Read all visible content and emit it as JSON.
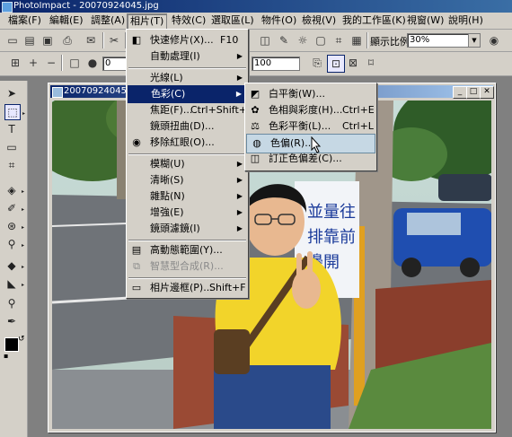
{
  "app": {
    "title": "PhotoImpact - 20070924045.jpg"
  },
  "menubar": {
    "items": [
      "檔案(F)",
      "編輯(E)",
      "調整(A)",
      "相片(T)",
      "特效(C)",
      "選取區(L)",
      "物件(O)",
      "檢視(V)",
      "我的工作區(K)",
      "視窗(W)",
      "說明(H)"
    ]
  },
  "toolbar": {
    "zoom_label": "顯示比例",
    "zoom_value": "30%"
  },
  "attr_bar": {
    "field_left_value": "0",
    "field_right_value": "100"
  },
  "document": {
    "title": "20070924045.jpg"
  },
  "photo_menu": {
    "items": [
      {
        "label": "快速修片(X)...",
        "shortcut": "F10"
      },
      {
        "label": "自動處理(I)",
        "shortcut": ""
      },
      {
        "label": "光線(L)",
        "shortcut": ""
      },
      {
        "label": "色彩(C)",
        "shortcut": ""
      },
      {
        "label": "焦距(F)...",
        "shortcut": "Ctrl+Shift+F"
      },
      {
        "label": "鏡頭扭曲(D)...",
        "shortcut": ""
      },
      {
        "label": "移除紅眼(O)...",
        "shortcut": ""
      },
      {
        "label": "模糊(U)",
        "shortcut": ""
      },
      {
        "label": "清晰(S)",
        "shortcut": ""
      },
      {
        "label": "雜點(N)",
        "shortcut": ""
      },
      {
        "label": "增強(E)",
        "shortcut": ""
      },
      {
        "label": "鏡頭濾鏡(I)",
        "shortcut": ""
      },
      {
        "label": "高動態範圍(Y)...",
        "shortcut": ""
      },
      {
        "label": "智慧型合成(R)...",
        "shortcut": ""
      },
      {
        "label": "相片邊框(P)...",
        "shortcut": "Shift+F"
      }
    ]
  },
  "color_submenu": {
    "items": [
      {
        "label": "白平衡(W)...",
        "shortcut": ""
      },
      {
        "label": "色相與彩度(H)...",
        "shortcut": "Ctrl+E"
      },
      {
        "label": "色彩平衡(L)...",
        "shortcut": "Ctrl+L"
      },
      {
        "label": "色偏(R)...",
        "shortcut": ""
      },
      {
        "label": "訂正色偏差(C)...",
        "shortcut": ""
      }
    ]
  },
  "sign": {
    "text": "並量往排靠前邊開"
  }
}
